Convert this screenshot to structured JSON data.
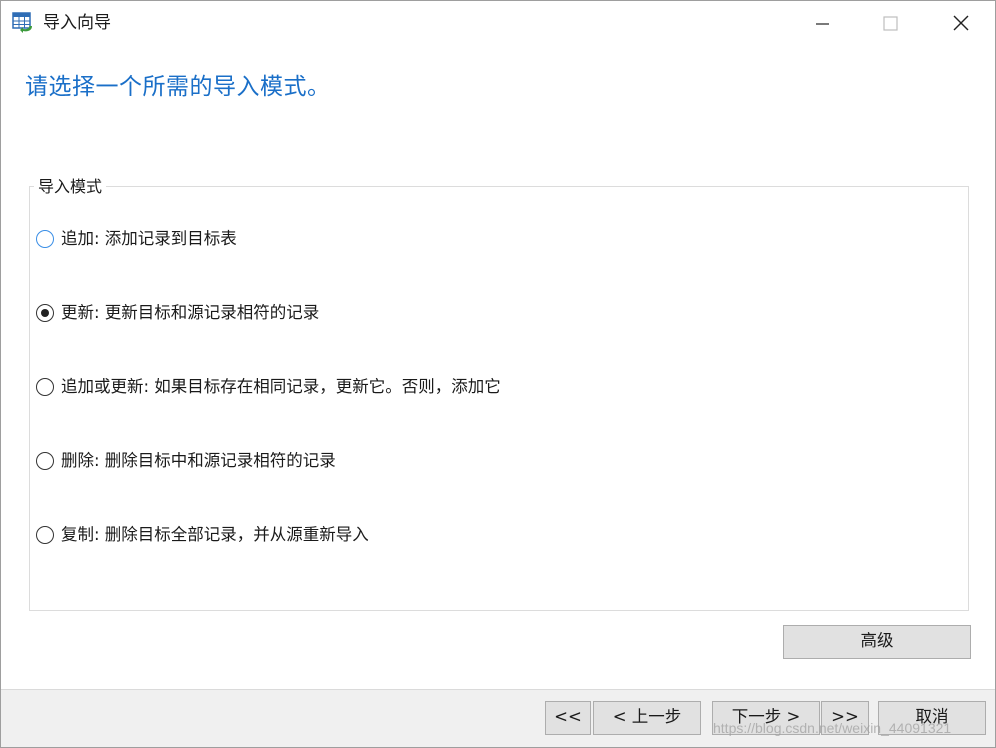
{
  "window": {
    "title": "导入向导",
    "icon": "table-import-icon",
    "controls": [
      "minimize-icon",
      "maximize-icon",
      "close-icon"
    ]
  },
  "heading": "请选择一个所需的导入模式。",
  "group": {
    "label": "导入模式",
    "options": [
      {
        "label": "追加: 添加记录到目标表",
        "checked": false,
        "focused": true
      },
      {
        "label": "更新: 更新目标和源记录相符的记录",
        "checked": true,
        "focused": false
      },
      {
        "label": "追加或更新: 如果目标存在相同记录，更新它。否则，添加它",
        "checked": false,
        "focused": false
      },
      {
        "label": "删除: 删除目标中和源记录相符的记录",
        "checked": false,
        "focused": false
      },
      {
        "label": "复制: 删除目标全部记录，并从源重新导入",
        "checked": false,
        "focused": false
      }
    ]
  },
  "buttons": {
    "advanced": "高级",
    "first": "<<",
    "prev": "< 上一步",
    "next": "下一步 >",
    "last": ">>",
    "cancel": "取消"
  },
  "watermark": "https://blog.csdn.net/weixin_44091321",
  "colors": {
    "heading": "#1a6fc8",
    "accent": "#3a8ee6",
    "footer_bg": "#f0f0f0",
    "button_bg": "#e1e1e1"
  }
}
